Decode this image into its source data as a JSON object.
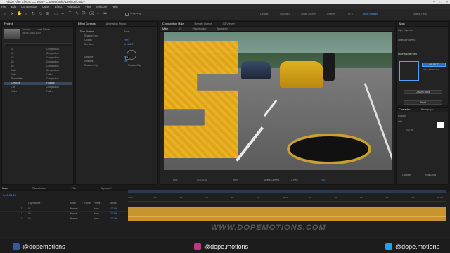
{
  "window": {
    "title": "Adobe After Effects CC 2019 - C:\\Users\\okko\\Desktop\\Loop *"
  },
  "menu": [
    "File",
    "Edit",
    "Composition",
    "Layer",
    "Effect",
    "Animation",
    "View",
    "Window",
    "Help"
  ],
  "toolbar": {
    "snapping_label": "Snapping"
  },
  "workspaces": [
    "Default",
    "Standard",
    "Small Screen",
    "Libraries",
    "SFX",
    "Dope motions",
    "Search Help"
  ],
  "project": {
    "tab": "Project",
    "selected_info": [
      "Creature",
      "used 1 times",
      "1920 x 1080 (1.00)"
    ],
    "items": [
      {
        "name": "01",
        "type": "Composition"
      },
      {
        "name": "02",
        "type": "Composition"
      },
      {
        "name": "03",
        "type": "Composition"
      },
      {
        "name": "04",
        "type": "Composition"
      },
      {
        "name": "05",
        "type": "Composition"
      },
      {
        "name": "Main",
        "type": "Composition"
      },
      {
        "name": "Main",
        "type": "Folder"
      },
      {
        "name": "Placeholder",
        "type": "Composition"
      },
      {
        "name": "Creature",
        "type": "Footage"
      },
      {
        "name": "Title",
        "type": "Composition"
      },
      {
        "name": "Video",
        "type": "Folder"
      }
    ]
  },
  "effects": {
    "tabs": [
      "Effect Controls",
      "Animation Studio"
    ],
    "effect_name": "Drop Shadow",
    "reset_label": "Reset",
    "props": [
      {
        "name": "Shadow Color",
        "value": ""
      },
      {
        "name": "Opacity",
        "value": "75%"
      },
      {
        "name": "Direction",
        "value": "0x+135.0°"
      },
      {
        "name": "Distance",
        "value": "300"
      },
      {
        "name": "Softness",
        "value": "150"
      },
      {
        "name": "Shadow Only",
        "value": "Shadow Only"
      }
    ]
  },
  "composition": {
    "tabs": [
      "Composition Main",
      "Render Queue",
      "3D Viewer"
    ],
    "subtabs": [
      "Main",
      "01",
      "Placeholder",
      "Alphabet"
    ],
    "zoom": "50%",
    "time": "0;00;01;20",
    "resolution": "Half",
    "camera": "Active Camera",
    "view": "1 View",
    "exposure": "+0.0",
    "overlay_letter": "S"
  },
  "right": {
    "align_title": "Align",
    "align_to": "Align Layers to:",
    "distribute": "Distribute Layers:",
    "move_anchor_title": "Move Anchor Point",
    "object_label": "OBJECT",
    "include_masks": "INCLUDE MASKS",
    "custom_label": "Custom Move",
    "reset_label": "Reset",
    "character_title": "Character",
    "paragraph_title": "Paragraph",
    "font_name": "Bungee",
    "font_style": "Italic",
    "font_size": "100 px",
    "ligatures": "Ligatures",
    "hindi_digits": "Hindi Digits"
  },
  "timeline": {
    "tabs": [
      "Main",
      "Placeholder",
      "Title",
      "Alphabet"
    ],
    "time": "0;00;01;15",
    "headers": [
      "Layer Name",
      "Mode",
      "T TrkMat",
      "Parent",
      "Stretch"
    ],
    "layers": [
      {
        "num": "1",
        "name": "01",
        "mode": "Normal",
        "parent": "None",
        "stretch": "100.0%"
      },
      {
        "num": "2",
        "name": "02",
        "mode": "Normal",
        "parent": "None",
        "stretch": "100.0%"
      },
      {
        "num": "3",
        "name": "03",
        "mode": "Normal",
        "parent": "None",
        "stretch": "100.0%"
      }
    ],
    "ruler": [
      "0:00f",
      "05f",
      "10f",
      "15f",
      "20f",
      "25f",
      "01:00f",
      "05f",
      "10f",
      "15f",
      "20f",
      "25f",
      "02:00f"
    ],
    "footer": "Toggle Switches / Modes"
  },
  "footer": {
    "facebook": "@dopemotions",
    "instagram": "@dope.motions",
    "twitter": "@dope.motions",
    "watermark": "WWW.DOPEMOTIONS.COM"
  },
  "colors": {
    "accent": "#4da0ff",
    "track": "#c6952e",
    "facebook": "#3b5998",
    "instagram": "#c13584",
    "twitter": "#1da1f2"
  }
}
